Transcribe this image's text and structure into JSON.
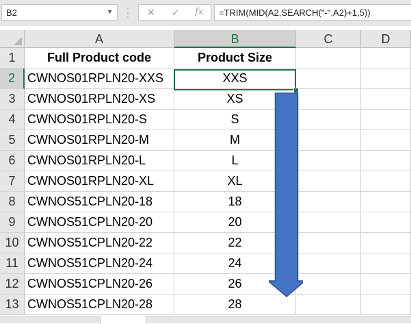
{
  "formula_bar": {
    "name_box": "B2",
    "cancel_icon": "✕",
    "enter_icon": "✓",
    "fx_label": "fx",
    "formula": "=TRIM(MID(A2,SEARCH(\"-\",A2)+1,5))"
  },
  "columns": [
    "A",
    "B",
    "C",
    "D"
  ],
  "rows": [
    "1",
    "2",
    "3",
    "4",
    "5",
    "6",
    "7",
    "8",
    "9",
    "10",
    "11",
    "12",
    "13"
  ],
  "header": {
    "a": "Full Product code",
    "b": "Product Size"
  },
  "data": [
    {
      "a": "CWNOS01RPLN20-XXS",
      "b": "XXS"
    },
    {
      "a": "CWNOS01RPLN20-XS",
      "b": "XS"
    },
    {
      "a": "CWNOS01RPLN20-S",
      "b": "S"
    },
    {
      "a": "CWNOS01RPLN20-M",
      "b": "M"
    },
    {
      "a": "CWNOS01RPLN20-L",
      "b": "L"
    },
    {
      "a": "CWNOS01RPLN20-XL",
      "b": "XL"
    },
    {
      "a": "CWNOS51CPLN20-18",
      "b": "18"
    },
    {
      "a": "CWNOS51CPLN20-20",
      "b": "20"
    },
    {
      "a": "CWNOS51CPLN20-22",
      "b": "22"
    },
    {
      "a": "CWNOS51CPLN20-24",
      "b": "24"
    },
    {
      "a": "CWNOS51CPLN20-26",
      "b": "26"
    },
    {
      "a": "CWNOS51CPLN20-28",
      "b": "28"
    }
  ],
  "colors": {
    "selection": "#217346",
    "arrow_fill": "#4472c4",
    "arrow_stroke": "#2f528f"
  },
  "icons": {
    "fill_down": "down-arrow-icon",
    "dropdown": "chevron-down-icon"
  }
}
